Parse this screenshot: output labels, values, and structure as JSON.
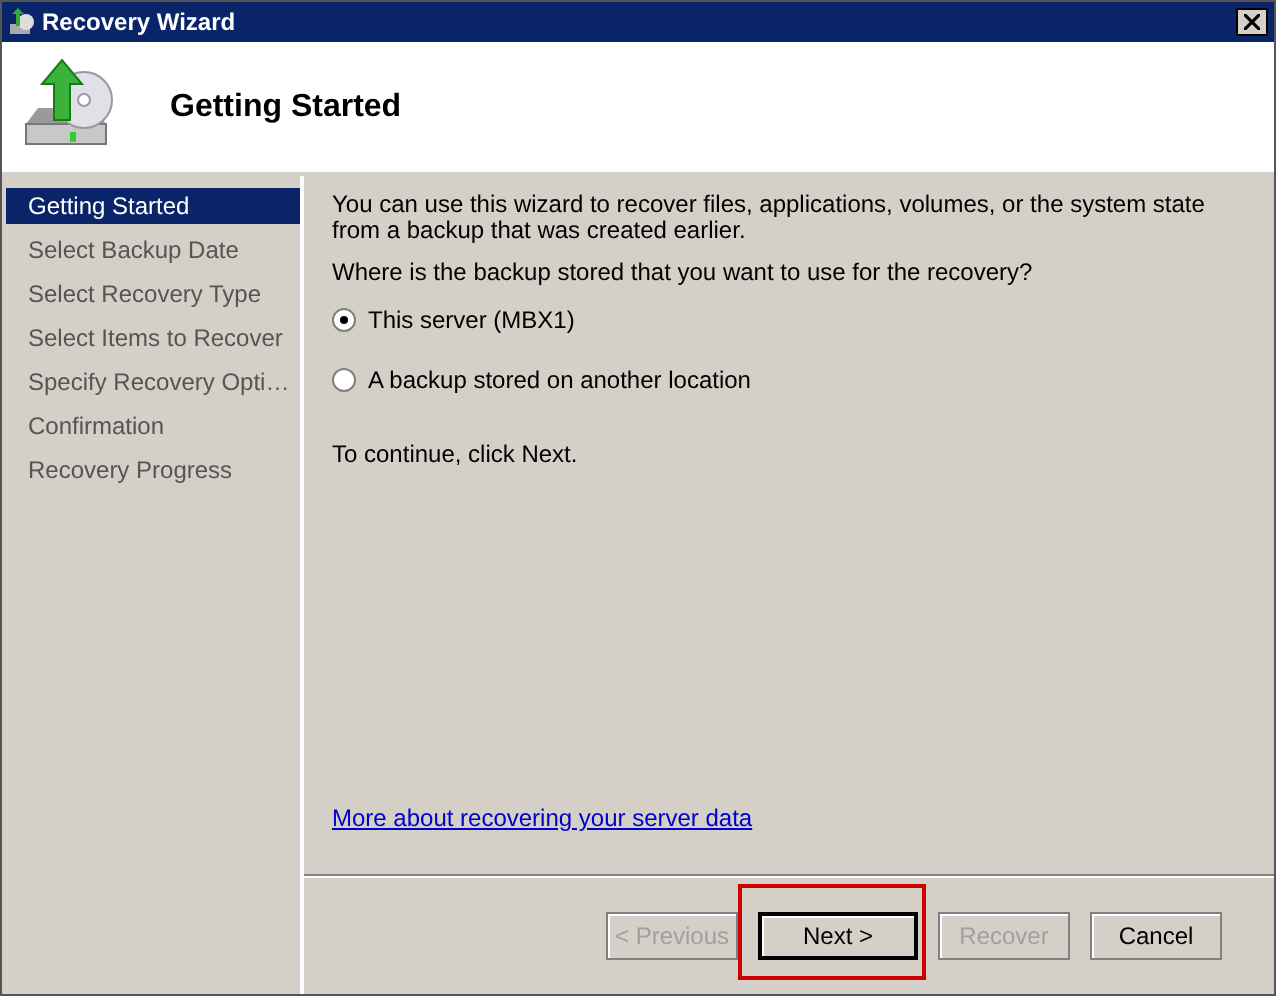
{
  "window": {
    "title": "Recovery Wizard"
  },
  "header": {
    "title": "Getting Started"
  },
  "steps": [
    {
      "label": "Getting Started",
      "selected": true
    },
    {
      "label": "Select Backup Date",
      "selected": false
    },
    {
      "label": "Select Recovery Type",
      "selected": false
    },
    {
      "label": "Select Items to Recover",
      "selected": false
    },
    {
      "label": "Specify Recovery Opti…",
      "selected": false
    },
    {
      "label": "Confirmation",
      "selected": false
    },
    {
      "label": "Recovery Progress",
      "selected": false
    }
  ],
  "intro": "You can use this wizard to recover files, applications, volumes, or the system state from a backup that was created earlier.",
  "question": "Where is the backup stored that you want to use for the recovery?",
  "options": [
    {
      "label": "This server (MBX1)",
      "selected": true
    },
    {
      "label": "A backup stored on another location",
      "selected": false
    }
  ],
  "instruction": "To continue, click Next.",
  "link": "More about recovering your server data",
  "buttons": [
    {
      "label": "< Previous",
      "disabled": true,
      "highlighted": false
    },
    {
      "label": "Next >",
      "disabled": false,
      "highlighted": true
    },
    {
      "label": "Recover",
      "disabled": true,
      "highlighted": false
    },
    {
      "label": "Cancel",
      "disabled": false,
      "highlighted": false
    }
  ]
}
